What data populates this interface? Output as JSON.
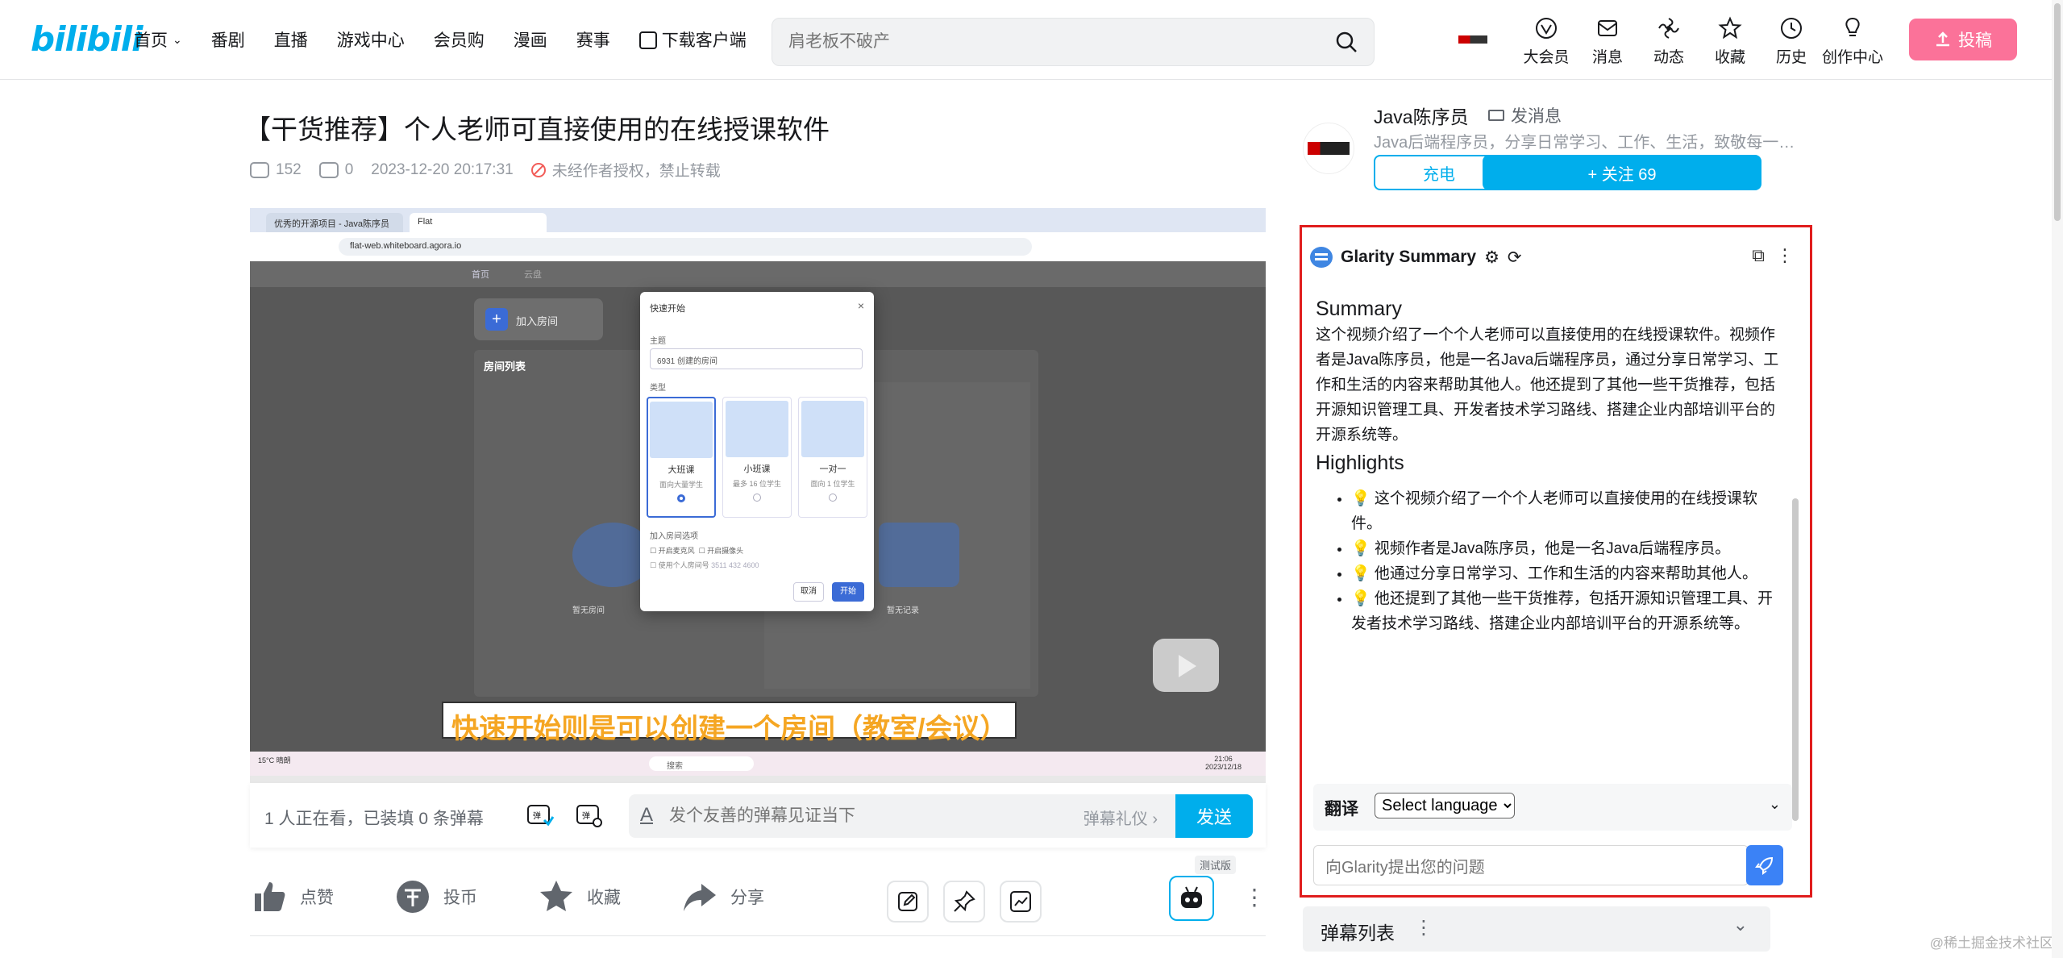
{
  "header": {
    "logo": "bilibili",
    "nav": [
      "首页",
      "番剧",
      "直播",
      "游戏中心",
      "会员购",
      "漫画",
      "赛事",
      "下载客户端"
    ],
    "search_placeholder": "肩老板不破产",
    "icons": [
      {
        "label": "大会员",
        "icon": "vip-icon"
      },
      {
        "label": "消息",
        "icon": "message-icon"
      },
      {
        "label": "动态",
        "icon": "dynamic-icon"
      },
      {
        "label": "收藏",
        "icon": "favorite-icon"
      },
      {
        "label": "历史",
        "icon": "history-icon"
      },
      {
        "label": "创作中心",
        "icon": "creator-icon"
      }
    ],
    "upload_label": "投稿"
  },
  "video": {
    "title": "【干货推荐】个人老师可直接使用的在线授课软件",
    "views": "152",
    "danmaku_count": "0",
    "date": "2023-12-20 20:17:31",
    "copyright": "未经作者授权，禁止转载"
  },
  "player": {
    "tabs": [
      "优秀的开源项目 - Java陈序员",
      "Flat"
    ],
    "url": "flat-web.whiteboard.agora.io",
    "app_nav": [
      "首页",
      "云盘"
    ],
    "add_room": "加入房间",
    "room_list": "房间列表",
    "empty_left": "暂无房间",
    "empty_right": "暂无记录",
    "dialog": {
      "title": "快速开始",
      "topic_label": "主题",
      "topic_value": "6931 创建的房间",
      "type_label": "类型",
      "options": [
        {
          "name": "大班课",
          "desc": "面向大量学生"
        },
        {
          "name": "小班课",
          "desc": "最多 16 位学生"
        },
        {
          "name": "一对一",
          "desc": "面向 1 位学生"
        }
      ],
      "join_label": "加入房间选项",
      "checkbox_1": "开启麦克风",
      "checkbox_2": "开启摄像头",
      "checkbox_3": "使用个人房间号",
      "checkbox_3_value": "3511 432 4600",
      "cancel": "取消",
      "start": "开始"
    },
    "subtitle": "快速开始则是可以创建一个房间（教室/会议）",
    "taskbar_search": "搜索",
    "weather": "15°C 晴朗",
    "clock_time": "21:06",
    "clock_date": "2023/12/18"
  },
  "danmaku_bar": {
    "watching": "1 人正在看，已装填 0 条弹幕",
    "input_placeholder": "发个友善的弹幕见证当下",
    "etiquette": "弹幕礼仪 ›",
    "send": "发送"
  },
  "actions": {
    "like": "点赞",
    "coin": "投币",
    "favorite": "收藏",
    "share": "分享",
    "beta": "测试版"
  },
  "uploader": {
    "name": "Java陈序员",
    "message": "发消息",
    "desc": "Java后端程序员，分享日常学习、工作、生活，致敬每一个…",
    "charge": "充电",
    "follow": "+ 关注 69"
  },
  "glarity": {
    "title": "Glarity Summary",
    "summary_heading": "Summary",
    "summary_text": "这个视频介绍了一个个人老师可以直接使用的在线授课软件。视频作者是Java陈序员，他是一名Java后端程序员，通过分享日常学习、工作和生活的内容来帮助其他人。他还提到了其他一些干货推荐，包括开源知识管理工具、开发者技术学习路线、搭建企业内部培训平台的开源系统等。",
    "highlights_heading": "Highlights",
    "highlights": [
      "💡 这个视频介绍了一个个人老师可以直接使用的在线授课软件。",
      "💡 视频作者是Java陈序员，他是一名Java后端程序员。",
      "💡 他通过分享日常学习、工作和生活的内容来帮助其他人。",
      "💡 他还提到了其他一些干货推荐，包括开源知识管理工具、开发者技术学习路线、搭建企业内部培训平台的开源系统等。"
    ],
    "translate_label": "翻译",
    "language_select": "Select language",
    "ask_placeholder": "向Glarity提出您的问题"
  },
  "danmaku_list": {
    "label": "弹幕列表"
  },
  "watermark": "@稀土掘金技术社区",
  "colors": {
    "brand": "#00aeec",
    "upload_pink": "#fb7299",
    "highlight_border": "#e01d1d"
  }
}
